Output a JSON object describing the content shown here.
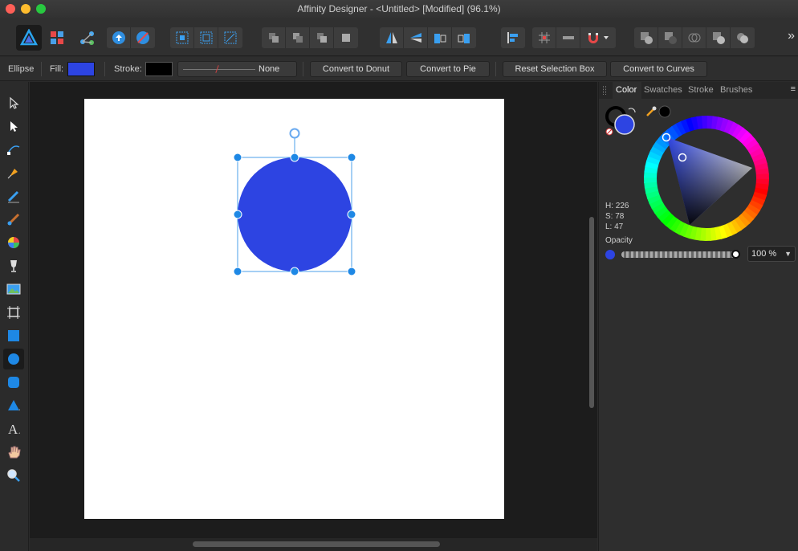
{
  "window": {
    "title": "Affinity Designer - <Untitled> [Modified] (96.1%)"
  },
  "toolbar": {
    "more_label": "»"
  },
  "context_bar": {
    "tool_name": "Ellipse",
    "fill_label": "Fill:",
    "stroke_label": "Stroke:",
    "stroke_width_value": "None",
    "fill_color": "#2d44e2",
    "stroke_color": "#000000",
    "buttons": {
      "convert_to_donut": "Convert to Donut",
      "convert_to_pie": "Convert to Pie",
      "reset_selection_box": "Reset Selection Box",
      "convert_to_curves": "Convert to Curves"
    }
  },
  "panel": {
    "tabs": {
      "color": "Color",
      "swatches": "Swatches",
      "stroke": "Stroke",
      "brushes": "Brushes"
    },
    "menu_icon": "≡",
    "hsl": {
      "h": "H: 226",
      "s": "S: 78",
      "l": "L: 47"
    },
    "opacity_label": "Opacity",
    "opacity_value": "100 %",
    "opacity_arrow": "▼",
    "opacity_fraction": 1.0
  },
  "document": {
    "shape": "ellipse",
    "fill_color": "#2d44e2",
    "selection_color": "#1e88e5"
  }
}
